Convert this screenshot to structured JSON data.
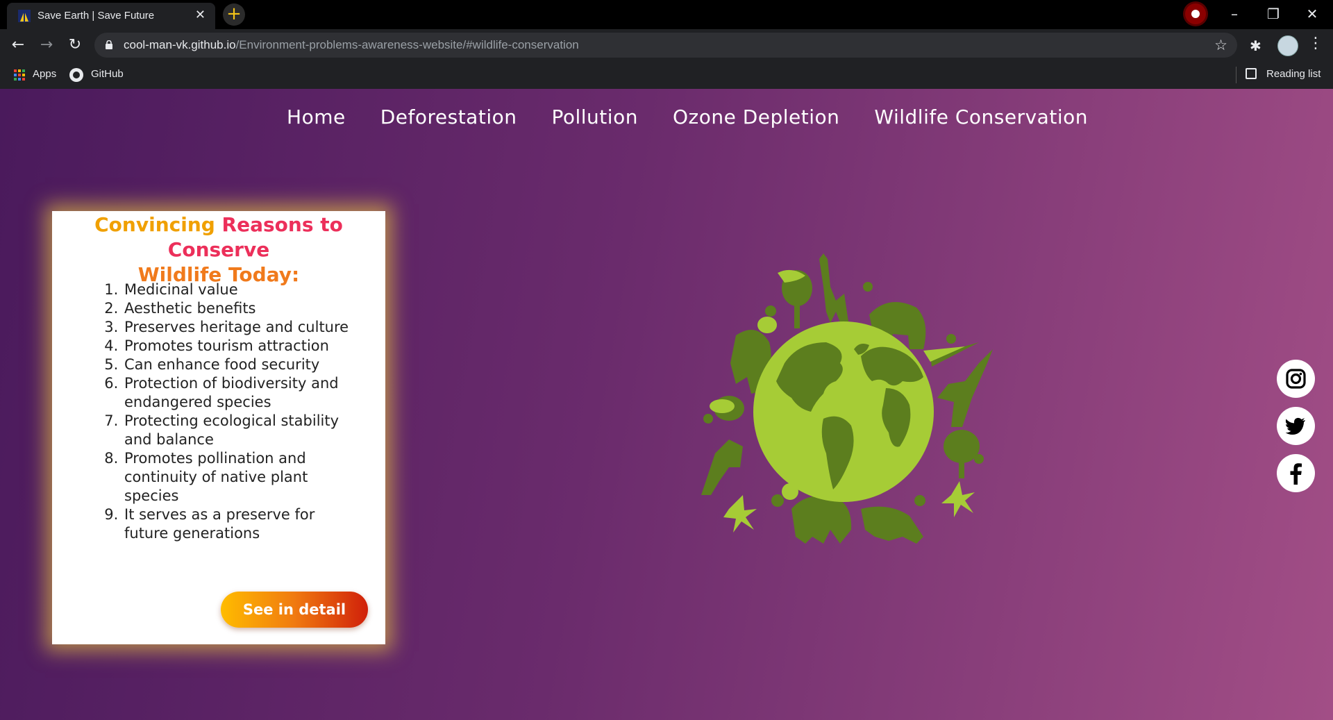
{
  "browser": {
    "tab_title": "Save Earth | Save Future",
    "tab_close": "✕",
    "new_tab": "+",
    "url_host": "cool-man-vk.github.io",
    "url_path": "/Environment-problems-awareness-website/#wildlife-conservation",
    "bookmarks": {
      "apps": "Apps",
      "github": "GitHub",
      "reading_list": "Reading list"
    },
    "icons": [
      "back-icon",
      "forward-icon",
      "reload-icon",
      "lock-icon",
      "star-icon",
      "extensions-icon",
      "avatar",
      "menu-icon"
    ]
  },
  "nav": {
    "items": [
      "Home",
      "Deforestation",
      "Pollution",
      "Ozone Depletion",
      "Wildlife Conservation"
    ]
  },
  "card": {
    "title_part1": "Convincing ",
    "title_part2": "Reasons to Conserve",
    "title_part3": "Wildlife Today:",
    "reasons": [
      "Medicinal value",
      "Aesthetic benefits",
      "Preserves heritage and culture",
      "Promotes tourism attraction",
      "Can enhance food security",
      "Protection of biodiversity and endangered species",
      "Protecting ecological stability and balance",
      "Promotes pollination and continuity of native plant species",
      "It serves as a preserve for future generations"
    ],
    "button_label": "See in detail"
  },
  "social": [
    "instagram-icon",
    "twitter-icon",
    "facebook-icon"
  ],
  "colors": {
    "page_gradient": [
      "#4a1a5c",
      "#a24e86"
    ],
    "card_glow": "#ffdc3c",
    "button_gradient": [
      "#ffbc00",
      "#d0200a"
    ],
    "globe_light": "#a6cc36",
    "globe_dark": "#5c7e1e"
  }
}
